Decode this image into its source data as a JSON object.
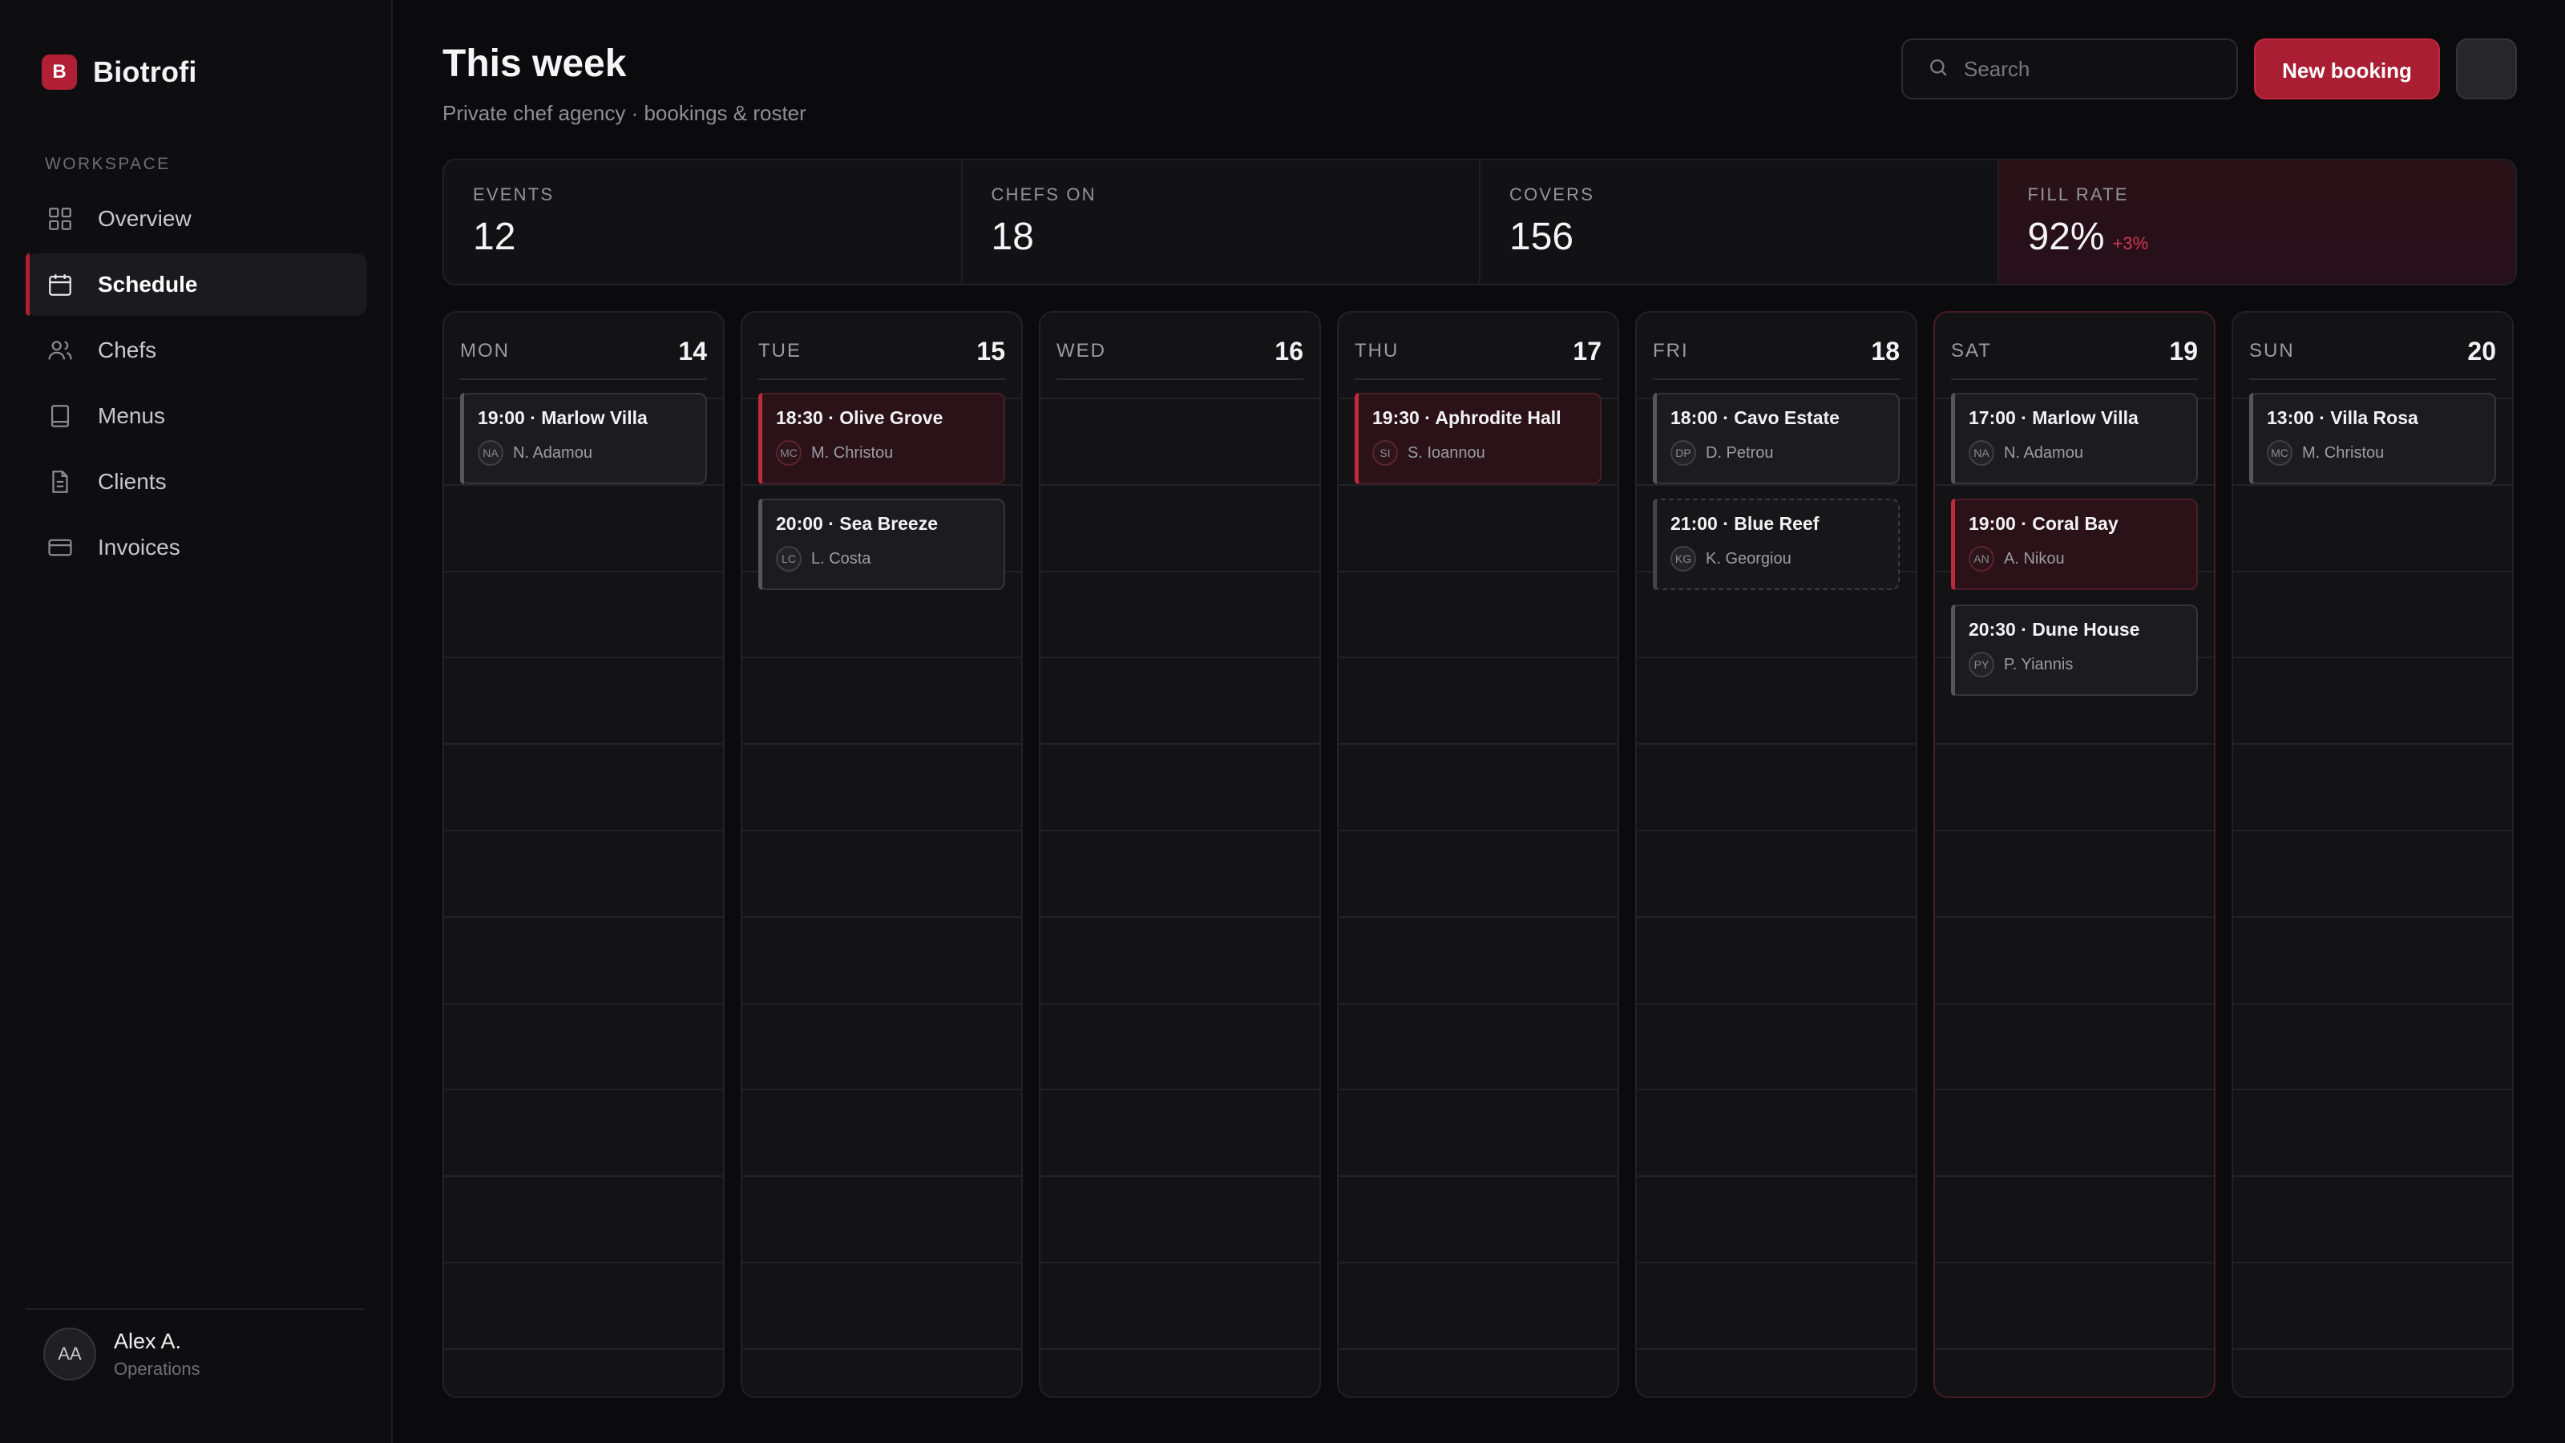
{
  "brand": {
    "logo_letter": "B",
    "name": "Biotrofi"
  },
  "sidebar": {
    "section_label": "WORKSPACE",
    "items": [
      {
        "label": "Overview",
        "icon": "grid-icon",
        "active": false
      },
      {
        "label": "Schedule",
        "icon": "calendar-icon",
        "active": true
      },
      {
        "label": "Chefs",
        "icon": "users-icon",
        "active": false
      },
      {
        "label": "Menus",
        "icon": "book-icon",
        "active": false
      },
      {
        "label": "Clients",
        "icon": "document-icon",
        "active": false
      },
      {
        "label": "Invoices",
        "icon": "card-icon",
        "active": false
      }
    ],
    "user": {
      "initials": "AA",
      "name": "Alex A.",
      "role": "Operations"
    }
  },
  "header": {
    "title": "This week",
    "subtitle": "Private chef agency · bookings & roster",
    "search_placeholder": "Search",
    "new_booking_label": "New booking"
  },
  "stats": [
    {
      "label": "EVENTS",
      "value": "12"
    },
    {
      "label": "CHEFS ON",
      "value": "18"
    },
    {
      "label": "COVERS",
      "value": "156"
    },
    {
      "label": "FILL RATE",
      "value": "92%",
      "delta": "+3%"
    }
  ],
  "colors": {
    "accent": "#a91e33",
    "background": "#0b0b0d",
    "panel": "#131315"
  },
  "days": [
    {
      "name": "MON",
      "num": "14",
      "highlight": false,
      "events": [
        {
          "title": "19:00 · Marlow Villa",
          "initials": "NA",
          "chef": "N. Adamou",
          "style": "normal"
        }
      ]
    },
    {
      "name": "TUE",
      "num": "15",
      "highlight": false,
      "events": [
        {
          "title": "18:30 · Olive Grove",
          "initials": "MC",
          "chef": "M. Christou",
          "style": "hot"
        },
        {
          "title": "20:00 · Sea Breeze",
          "initials": "LC",
          "chef": "L. Costa",
          "style": "normal"
        }
      ]
    },
    {
      "name": "WED",
      "num": "16",
      "highlight": false,
      "events": []
    },
    {
      "name": "THU",
      "num": "17",
      "highlight": false,
      "events": [
        {
          "title": "19:30 · Aphrodite Hall",
          "initials": "SI",
          "chef": "S. Ioannou",
          "style": "hot"
        }
      ]
    },
    {
      "name": "FRI",
      "num": "18",
      "highlight": false,
      "events": [
        {
          "title": "18:00 · Cavo Estate",
          "initials": "DP",
          "chef": "D. Petrou",
          "style": "normal"
        },
        {
          "title": "21:00 · Blue Reef",
          "initials": "KG",
          "chef": "K. Georgiou",
          "style": "tentative"
        }
      ]
    },
    {
      "name": "SAT",
      "num": "19",
      "highlight": true,
      "events": [
        {
          "title": "17:00 · Marlow Villa",
          "initials": "NA",
          "chef": "N. Adamou",
          "style": "normal"
        },
        {
          "title": "19:00 · Coral Bay",
          "initials": "AN",
          "chef": "A. Nikou",
          "style": "hot"
        },
        {
          "title": "20:30 · Dune House",
          "initials": "PY",
          "chef": "P. Yiannis",
          "style": "normal"
        }
      ]
    },
    {
      "name": "SUN",
      "num": "20",
      "highlight": false,
      "events": [
        {
          "title": "13:00 · Villa Rosa",
          "initials": "MC",
          "chef": "M. Christou",
          "style": "normal"
        }
      ]
    }
  ]
}
